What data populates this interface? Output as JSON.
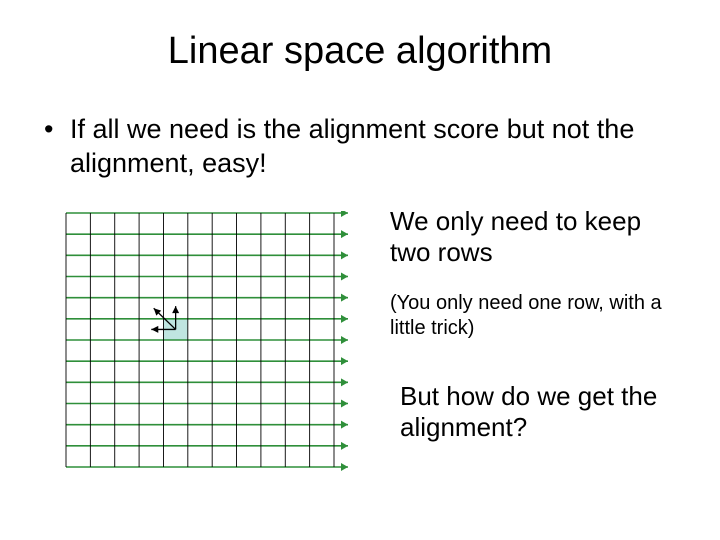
{
  "title": "Linear space algorithm",
  "bullet": "If all we need is the alignment score but not the alignment, easy!",
  "side1": "We only need to keep two rows",
  "side2": "(You only need one row, with a little trick)",
  "side3": "But how do we get the alignment?",
  "diagram": {
    "cols": 11,
    "rows": 12,
    "highlight_row": 5,
    "highlight_col": 4
  }
}
